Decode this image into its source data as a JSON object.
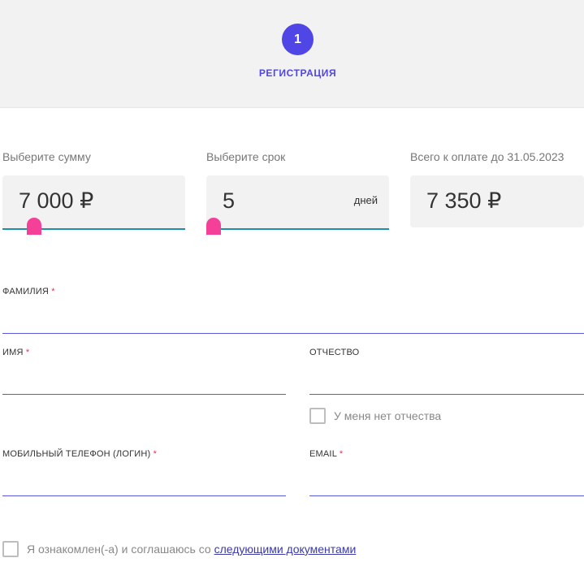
{
  "steps": {
    "current_number": "1",
    "current_label": "РЕГИСТРАЦИЯ"
  },
  "calculator": {
    "amount": {
      "label": "Выберите сумму",
      "value": "7 000 ₽",
      "slider_fraction": 0.05
    },
    "term": {
      "label": "Выберите срок",
      "value": "5",
      "unit": "дней",
      "slider_fraction": 0.0
    },
    "total": {
      "label": "Всего к оплате до 31.05.2023",
      "value": "7 350 ₽"
    }
  },
  "form": {
    "surname": {
      "label": "ФАМИЛИЯ",
      "required_mark": "*",
      "value": ""
    },
    "name": {
      "label": "ИМЯ",
      "required_mark": "*",
      "value": ""
    },
    "patronymic": {
      "label": "ОТЧЕСТВО",
      "value": ""
    },
    "no_patronymic": {
      "label": "У меня нет отчества",
      "checked": false
    },
    "phone": {
      "label": "МОБИЛЬНЫЙ ТЕЛЕФОН (ЛОГИН)",
      "required_mark": "*",
      "value": ""
    },
    "email": {
      "label": "EMAIL",
      "required_mark": "*",
      "value": ""
    },
    "agreement": {
      "text": "Я ознакомлен(-а) и соглашаюсь со ",
      "link_text": "следующими документами",
      "checked": false
    }
  },
  "colors": {
    "accent": "#5046e5",
    "slider_track": "#1e8fa8",
    "slider_thumb": "#f5409a",
    "required": "#e0345a",
    "field_underline": "#5a5ad6"
  }
}
